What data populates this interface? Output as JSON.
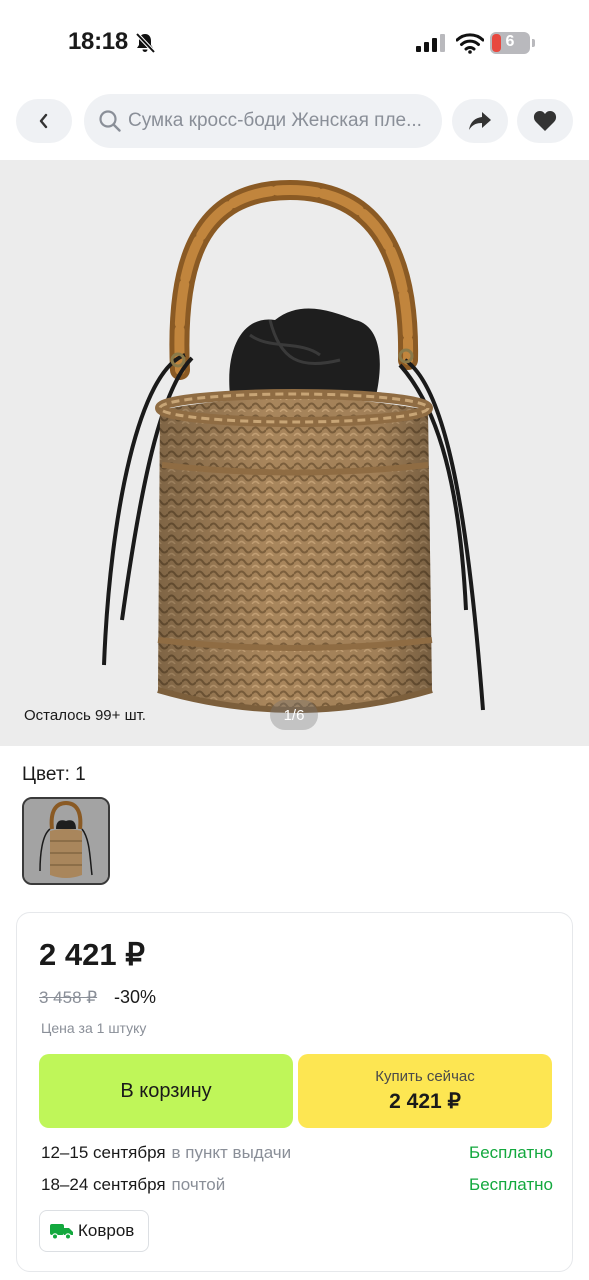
{
  "status_bar": {
    "time": "18:18",
    "battery_level": "6",
    "icons": [
      "bell-slash-icon",
      "cellular-signal-icon",
      "wifi-icon",
      "battery-icon"
    ]
  },
  "nav": {
    "back_icon": "chevron-left-icon",
    "search_placeholder": "Сумка кросс-боди Женская пле...",
    "share_icon": "share-arrow-icon",
    "favorite_icon": "heart-icon"
  },
  "gallery": {
    "stock_text": "Осталось 99+ шт.",
    "counter": "1/6"
  },
  "color": {
    "label": "Цвет: 1"
  },
  "price": {
    "current": "2 421 ₽",
    "old": "3 458 ₽",
    "discount": "-30%",
    "note": "Цена за 1 штуку"
  },
  "actions": {
    "cart_label": "В корзину",
    "buy_label": "Купить сейчас",
    "buy_price": "2 421 ₽"
  },
  "delivery": [
    {
      "dates": "12–15 сентября",
      "method": "в пункт выдачи",
      "price": "Бесплатно"
    },
    {
      "dates": "18–24 сентября",
      "method": "почтой",
      "price": "Бесплатно"
    }
  ],
  "seller": {
    "name": "Ковров",
    "icon": "truck-icon"
  },
  "colors": {
    "cart_button": "#bff659",
    "buy_button": "#fde652",
    "free_delivery": "#13a83e"
  }
}
